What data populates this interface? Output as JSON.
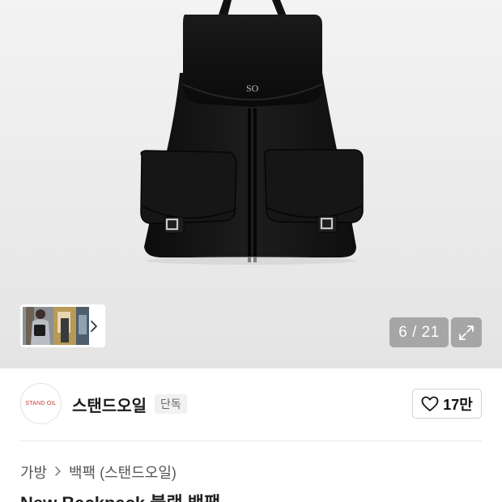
{
  "gallery": {
    "counter": "6 / 21",
    "photo_logo": "SO",
    "expand_icon": "expand-arrows-icon",
    "thumbnail_next_icon": "chevron-right-icon"
  },
  "brand": {
    "logo_text": "STAND OIL",
    "name": "스탠드오일",
    "badge": "단독",
    "likes": "17만",
    "like_icon": "heart-outline-icon"
  },
  "breadcrumb": {
    "level1": "가방",
    "separator_icon": "chevron-right-icon",
    "level2": "백팩 (스탠드오일)"
  },
  "product": {
    "title": "New Backpack 블랙 백팩"
  }
}
